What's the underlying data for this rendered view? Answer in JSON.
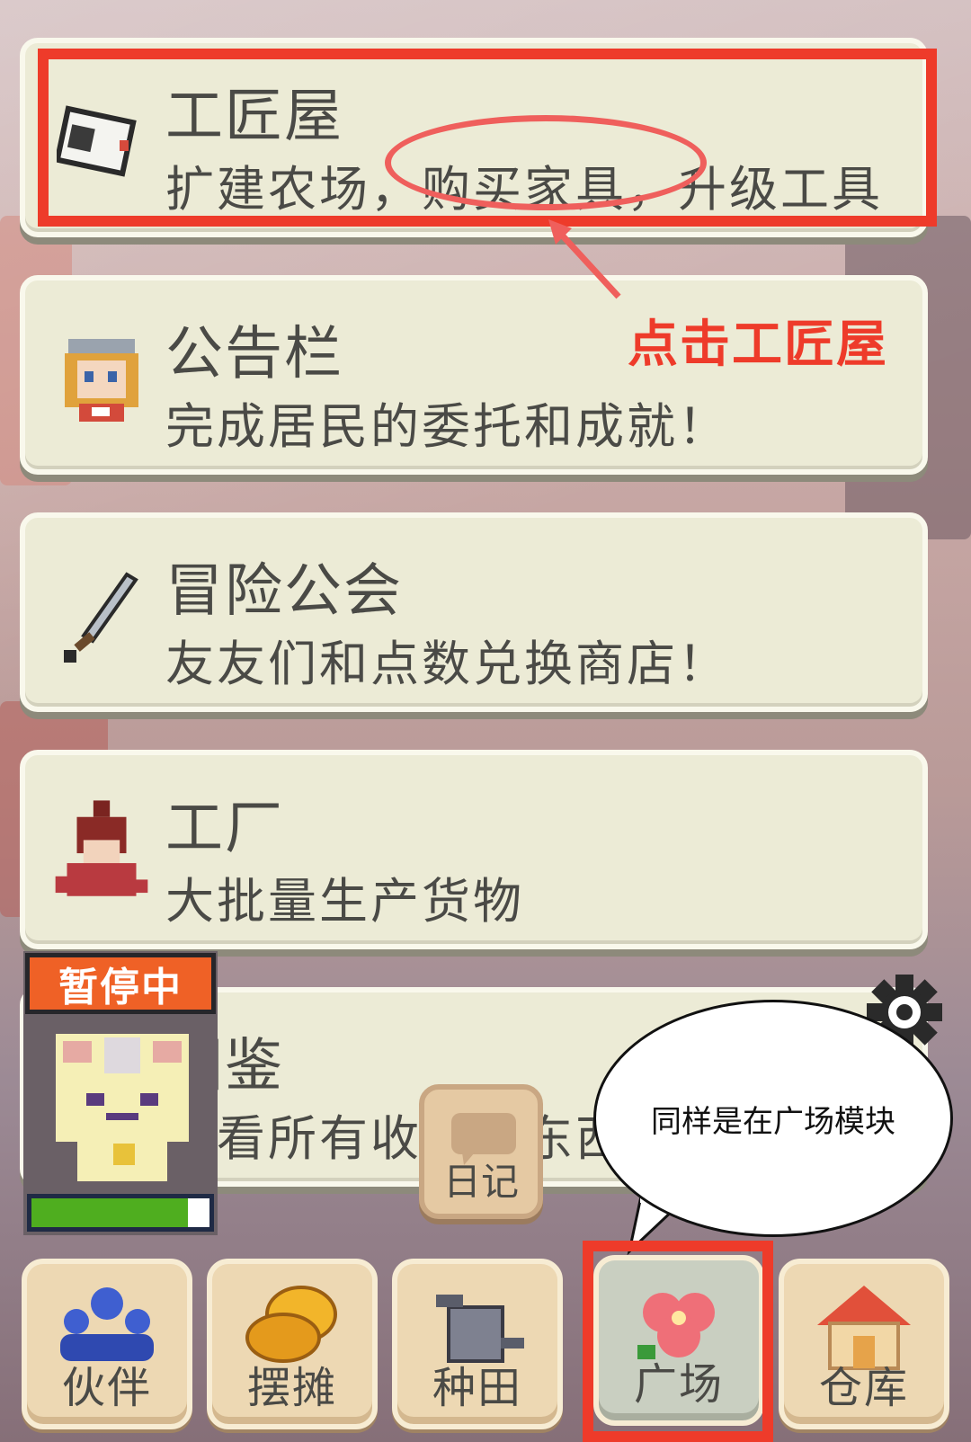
{
  "menu_items": [
    {
      "icon": "mallet-icon",
      "title": "工匠屋",
      "desc": "扩建农场，购买家具，升级工具"
    },
    {
      "icon": "girl-portrait-icon",
      "title": "公告栏",
      "desc": "完成居民的委托和成就！"
    },
    {
      "icon": "sword-icon",
      "title": "冒险公会",
      "desc": "友友们和点数兑换商店！"
    },
    {
      "icon": "mascot-icon",
      "title": "工厂",
      "desc": "大批量生产货物"
    },
    {
      "icon": "book-icon",
      "title": "图鉴",
      "desc": "查看所有收集的东西"
    }
  ],
  "annotations": {
    "click_hint": "点击工匠屋",
    "speech": "同样是在广场模块"
  },
  "status": {
    "paused_label": "暂停中",
    "progress": 0.88
  },
  "diary_button": {
    "label": "日记"
  },
  "tabs": [
    {
      "icon": "people-icon",
      "label": "伙伴"
    },
    {
      "icon": "coins-icon",
      "label": "摆摊"
    },
    {
      "icon": "watering-can-icon",
      "label": "种田"
    },
    {
      "icon": "flower-icon",
      "label": "广场"
    },
    {
      "icon": "house-icon",
      "label": "仓库"
    }
  ],
  "colors": {
    "highlight": "#ee3b2a",
    "badge": "#ef6126",
    "progress": "#4fae1f"
  }
}
